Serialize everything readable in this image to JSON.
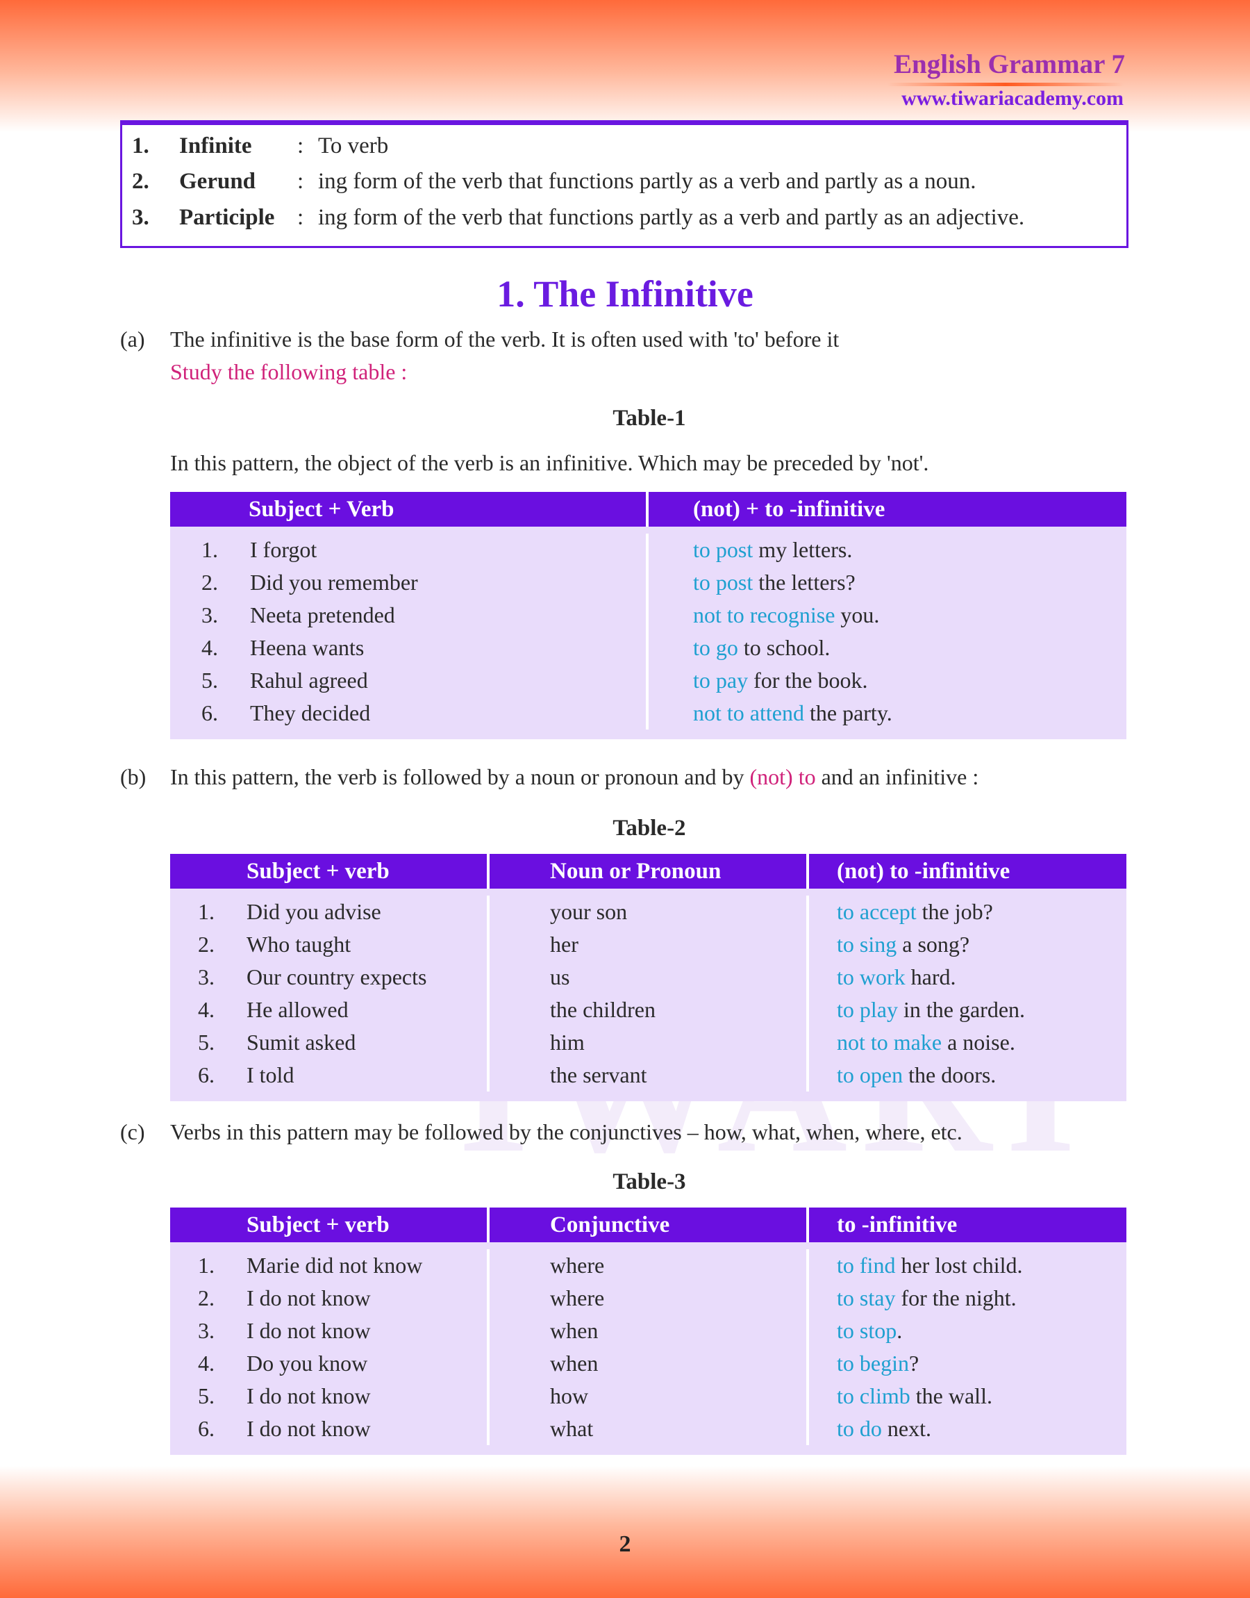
{
  "header": {
    "book_title": "English Grammar 7",
    "website": "www.tiwariacademy.com"
  },
  "definitions": [
    {
      "num": "1.",
      "term": "Infinite",
      "sep": ":",
      "text": "To verb"
    },
    {
      "num": "2.",
      "term": "Gerund",
      "sep": ":",
      "text": "ing form of the verb that functions partly as a verb and partly as a noun."
    },
    {
      "num": "3.",
      "term": "Participle",
      "sep": ":",
      "text": "ing form of the verb that functions partly as a verb and partly as an adjective."
    }
  ],
  "section_title": "1. The Infinitive",
  "para_a": {
    "label": "(a)",
    "text": "The infinitive is the base form of the verb. It is often used with 'to' before it",
    "study": "Study the following table :"
  },
  "table1": {
    "label": "Table-1",
    "intro": "In this pattern, the object of the verb is an infinitive. Which may be preceded by 'not'.",
    "headers": [
      "Subject + Verb",
      "(not) + to -infinitive"
    ],
    "rows": [
      [
        {
          "num": "1.",
          "text": "I forgot"
        },
        {
          "hl": "to post",
          "rest": " my letters."
        }
      ],
      [
        {
          "num": "2.",
          "text": "Did you remember"
        },
        {
          "hl": "to post",
          "rest": " the letters?"
        }
      ],
      [
        {
          "num": "3.",
          "text": "Neeta pretended"
        },
        {
          "hl": "not to recognise",
          "rest": " you."
        }
      ],
      [
        {
          "num": "4.",
          "text": "Heena wants"
        },
        {
          "hl": "to go",
          "rest": " to school."
        }
      ],
      [
        {
          "num": "5.",
          "text": "Rahul agreed"
        },
        {
          "hl": "to pay",
          "rest": " for the book."
        }
      ],
      [
        {
          "num": "6.",
          "text": "They decided"
        },
        {
          "hl": "not to attend",
          "rest": " the party."
        }
      ]
    ]
  },
  "para_b": {
    "label": "(b)",
    "text_before": "In this pattern, the verb is followed by a noun or pronoun and by ",
    "highlight": "(not) to",
    "text_after": " and an infinitive :"
  },
  "table2": {
    "label": "Table-2",
    "headers": [
      "Subject + verb",
      "Noun or Pronoun",
      "(not) to -infinitive"
    ],
    "rows": [
      [
        {
          "num": "1.",
          "text": "Did you advise"
        },
        {
          "text": "your son"
        },
        {
          "hl": "to accept",
          "rest": " the job?"
        }
      ],
      [
        {
          "num": "2.",
          "text": "Who taught"
        },
        {
          "text": "her"
        },
        {
          "hl": "to sing",
          "rest": " a song?"
        }
      ],
      [
        {
          "num": "3.",
          "text": "Our country expects"
        },
        {
          "text": "us"
        },
        {
          "hl": "to work",
          "rest": " hard."
        }
      ],
      [
        {
          "num": "4.",
          "text": "He allowed"
        },
        {
          "text": "the children"
        },
        {
          "hl": "to play",
          "rest": " in the garden."
        }
      ],
      [
        {
          "num": "5.",
          "text": "Sumit asked"
        },
        {
          "text": "him"
        },
        {
          "hl": "not to make",
          "rest": " a noise."
        }
      ],
      [
        {
          "num": "6.",
          "text": "I told"
        },
        {
          "text": "the servant"
        },
        {
          "hl": "to open",
          "rest": " the doors."
        }
      ]
    ]
  },
  "para_c": {
    "label": "(c)",
    "text": "Verbs in this pattern may be followed by the conjunctives – how, what, when, where, etc."
  },
  "table3": {
    "label": "Table-3",
    "headers": [
      "Subject + verb",
      "Conjunctive",
      "to -infinitive"
    ],
    "rows": [
      [
        {
          "num": "1.",
          "text": "Marie did not know"
        },
        {
          "text": "where"
        },
        {
          "hl": "to find",
          "rest": " her lost child."
        }
      ],
      [
        {
          "num": "2.",
          "text": "I do not know"
        },
        {
          "text": "where"
        },
        {
          "hl": "to stay",
          "rest": " for the night."
        }
      ],
      [
        {
          "num": "3.",
          "text": "I do not know"
        },
        {
          "text": "when"
        },
        {
          "hl": "to stop",
          "rest": "."
        }
      ],
      [
        {
          "num": "4.",
          "text": "Do you know"
        },
        {
          "text": "when"
        },
        {
          "hl": "to begin",
          "rest": "?"
        }
      ],
      [
        {
          "num": "5.",
          "text": "I do not know"
        },
        {
          "text": "how"
        },
        {
          "hl": "to climb",
          "rest": " the wall."
        }
      ],
      [
        {
          "num": "6.",
          "text": "I do not know"
        },
        {
          "text": "what"
        },
        {
          "hl": "to do",
          "rest": " next."
        }
      ]
    ]
  },
  "page_number": "2",
  "watermark": "TIWARI ACADEMY",
  "colors": {
    "header_purple": "#6a0fe0",
    "table_body": "#e9dcfb",
    "highlight_cyan": "#1fa0d0",
    "highlight_pink": "#d0227a",
    "banner_orange": "#ff6a3a"
  }
}
